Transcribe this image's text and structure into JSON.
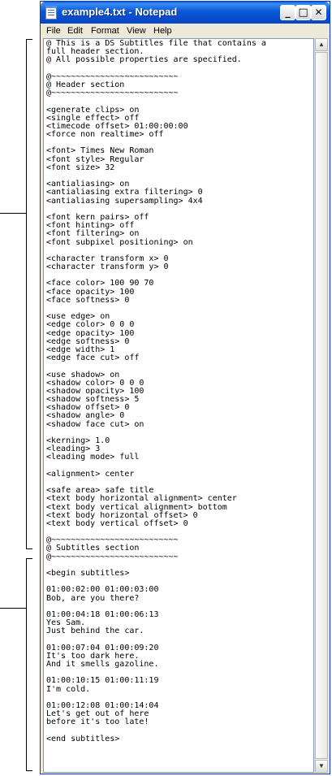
{
  "window": {
    "title": "example4.txt - Notepad"
  },
  "title_buttons": {
    "minimize": "_",
    "maximize": "□",
    "close": "✕"
  },
  "menu": [
    "File",
    "Edit",
    "Format",
    "View",
    "Help"
  ],
  "scrollbar": {
    "up_arrow": "▲",
    "down_arrow": "▼"
  },
  "document": {
    "lines": [
      "@ This is a DS Subtitles file that contains a",
      "full header section.",
      "@ All possible properties are specified.",
      "",
      "@~~~~~~~~~~~~~~~~~~~~~~~~~~",
      "@ Header section",
      "@~~~~~~~~~~~~~~~~~~~~~~~~~~",
      "",
      "<generate clips> on",
      "<single effect> off",
      "<timecode offset> 01:00:00:00",
      "<force non realtime> off",
      "",
      "<font> Times New Roman",
      "<font style> Regular",
      "<font size> 32",
      "",
      "<antialiasing> on",
      "<antialiasing extra filtering> 0",
      "<antialiasing supersampling> 4x4",
      "",
      "<font kern pairs> off",
      "<font hinting> off",
      "<font filtering> on",
      "<font subpixel positioning> on",
      "",
      "<character transform x> 0",
      "<character transform y> 0",
      "",
      "<face color> 100 90 70",
      "<face opacity> 100",
      "<face softness> 0",
      "",
      "<use edge> on",
      "<edge color> 0 0 0",
      "<edge opacity> 100",
      "<edge softness> 0",
      "<edge width> 1",
      "<edge face cut> off",
      "",
      "<use shadow> on",
      "<shadow color> 0 0 0",
      "<shadow opacity> 100",
      "<shadow softness> 5",
      "<shadow offset> 0",
      "<shadow angle> 0",
      "<shadow face cut> on",
      "",
      "<kerning> 1.0",
      "<leading> 3",
      "<leading mode> full",
      "",
      "<alignment> center",
      "",
      "<safe area> safe title",
      "<text body horizontal alignment> center",
      "<text body vertical alignment> bottom",
      "<text body horizontal offset> 0",
      "<text body vertical offset> 0",
      "",
      "@~~~~~~~~~~~~~~~~~~~~~~~~~~",
      "@ Subtitles section",
      "@~~~~~~~~~~~~~~~~~~~~~~~~~~",
      "",
      "<begin subtitles>",
      "",
      "01:00:02:00 01:00:03:00",
      "Bob, are you there?",
      "",
      "01:00:04:18 01:00:06:13",
      "Yes Sam.",
      "Just behind the car.",
      "",
      "01:00:07:04 01:00:09:20",
      "It's too dark here.",
      "And it smells gazoline.",
      "",
      "01:00:10:15 01:00:11:19",
      "I'm cold.",
      "",
      "01:00:12:08 01:00:14:04",
      "Let's get out of here",
      "before it's too late!",
      "",
      "<end subtitles>"
    ]
  }
}
